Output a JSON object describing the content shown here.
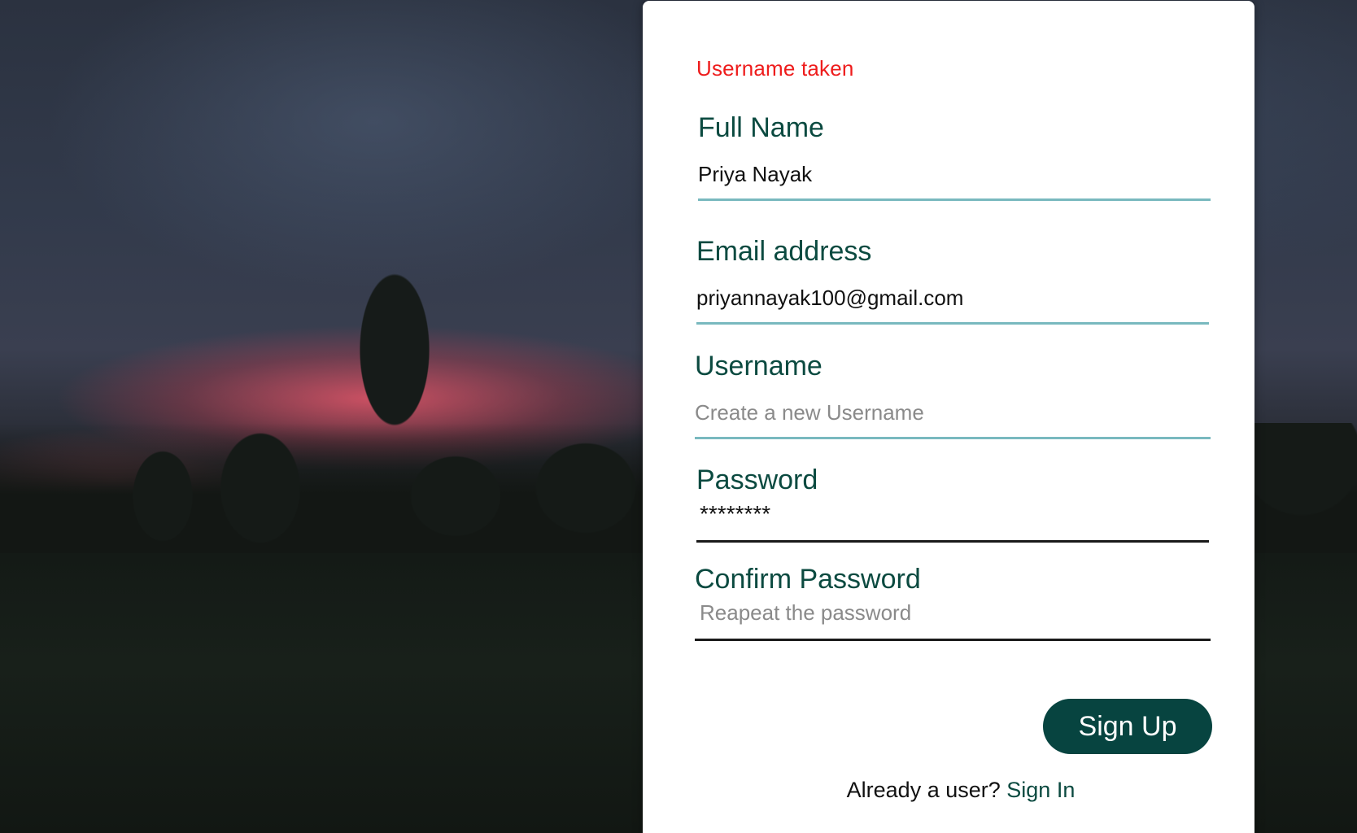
{
  "form": {
    "error_message": "Username taken",
    "full_name": {
      "label": "Full Name",
      "value": "Priya Nayak",
      "placeholder": ""
    },
    "email": {
      "label": "Email address",
      "value": "priyannayak100@gmail.com",
      "placeholder": ""
    },
    "username": {
      "label": "Username",
      "value": "",
      "placeholder": "Create a new Username"
    },
    "password": {
      "label": "Password",
      "value": "********",
      "placeholder": ""
    },
    "confirm_password": {
      "label": "Confirm Password",
      "value": "",
      "placeholder": "Reapeat the password"
    },
    "submit_label": "Sign Up",
    "signin_prompt": "Already a user?",
    "signin_link": "Sign In"
  },
  "colors": {
    "accent": "#074440",
    "label_text": "#0b4a40",
    "error": "#ee1c1c",
    "input_underline": "#79b9bf"
  }
}
